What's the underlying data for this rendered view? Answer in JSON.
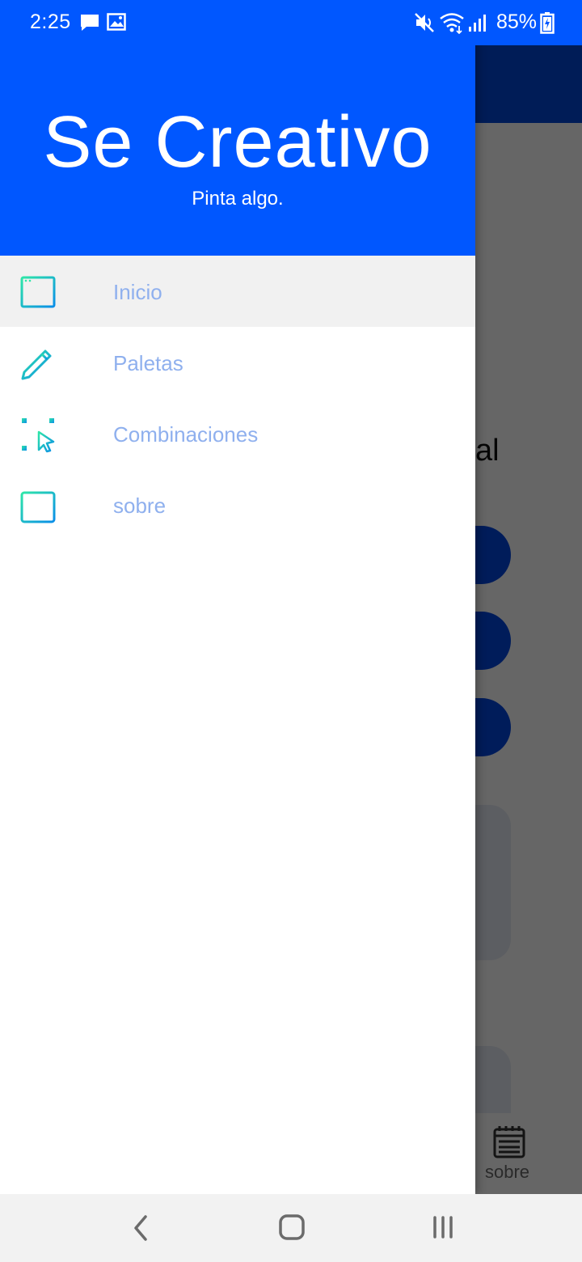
{
  "status_bar": {
    "time": "2:25",
    "battery_percent": "85%",
    "icons": [
      "message-icon",
      "image-icon",
      "mute-icon",
      "wifi-icon",
      "signal-icon",
      "battery-charging-icon"
    ]
  },
  "background_app": {
    "heading_fragment": "al",
    "bottom_nav": {
      "label": "sobre",
      "icon": "notepad-icon"
    }
  },
  "drawer": {
    "title": "Se Creativo",
    "subtitle": "Pinta algo.",
    "items": [
      {
        "label": "Inicio",
        "icon": "browser-window-icon",
        "active": true
      },
      {
        "label": "Paletas",
        "icon": "pencil-icon",
        "active": false
      },
      {
        "label": "Combinaciones",
        "icon": "selection-cursor-icon",
        "active": false
      },
      {
        "label": "sobre",
        "icon": "notepad-icon",
        "active": false
      }
    ]
  },
  "nav_bar": {
    "buttons": [
      "back-icon",
      "home-icon",
      "recents-icon"
    ]
  },
  "colors": {
    "header_blue": "#0057ff",
    "toolbar_blue": "#0048d9",
    "menu_text": "#8fb0ee",
    "icon_gradient_start": "#2ee6a8",
    "icon_gradient_end": "#0a8ee8",
    "active_item_bg": "#f1f1f1"
  }
}
